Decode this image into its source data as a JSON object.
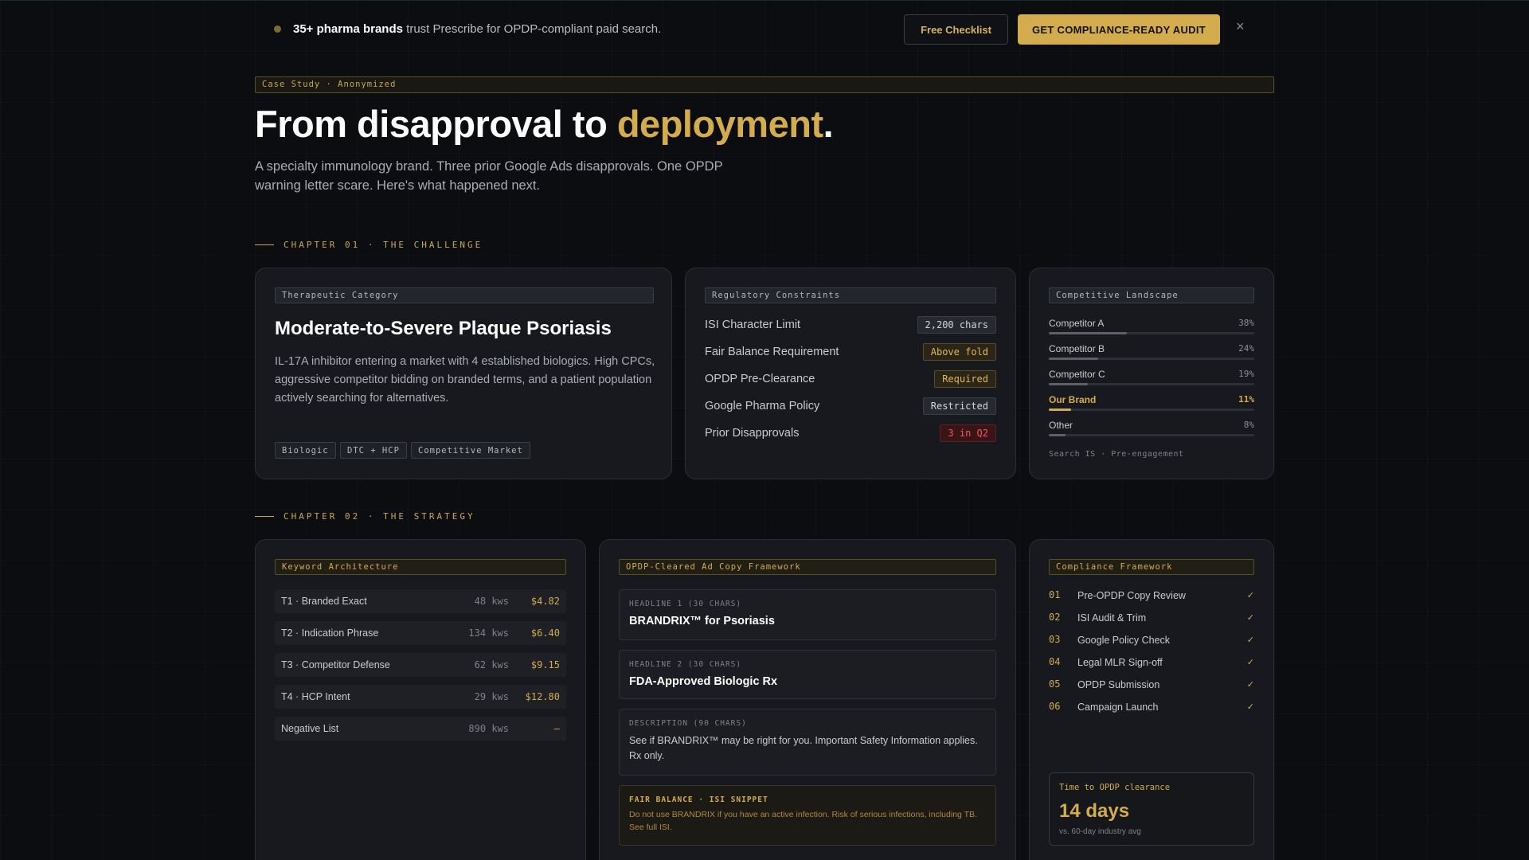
{
  "banner": {
    "highlight": "35+ pharma brands",
    "message": " trust Prescribe for OPDP-compliant paid search.",
    "free_checklist": "Free Checklist",
    "cta": "GET COMPLIANCE-READY AUDIT",
    "close": "×"
  },
  "hero": {
    "eyebrow": "Case Study · Anonymized",
    "title_part1": "From disapproval to ",
    "title_accent": "deployment",
    "title_end": ".",
    "subtitle": "A specialty immunology brand. Three prior Google Ads disapprovals. One OPDP warning letter scare. Here's what happened next."
  },
  "chapter1": "CHAPTER 01 · THE CHALLENGE",
  "chapter2": "CHAPTER 02 · THE STRATEGY",
  "therapeutic": {
    "tag": "Therapeutic Category",
    "title": "Moderate-to-Severe Plaque Psoriasis",
    "description": "IL-17A inhibitor entering a market with 4 established biologics. High CPCs, aggressive competitor bidding on branded terms, and a patient population actively searching for alternatives.",
    "chips": [
      "Biologic",
      "DTC + HCP",
      "Competitive Market"
    ]
  },
  "regulatory": {
    "tag": "Regulatory Constraints",
    "rows": [
      {
        "label": "ISI Character Limit",
        "value": "2,200 chars"
      },
      {
        "label": "Fair Balance Requirement",
        "value": "Above fold"
      },
      {
        "label": "OPDP Pre-Clearance",
        "value": "Required"
      },
      {
        "label": "Google Pharma Policy",
        "value": "Restricted"
      },
      {
        "label": "Prior Disapprovals",
        "value": "3 in Q2"
      }
    ]
  },
  "competitive": {
    "tag": "Competitive Landscape",
    "items": [
      {
        "name": "Competitor A",
        "pct": "38%",
        "share": 38
      },
      {
        "name": "Competitor B",
        "pct": "24%",
        "share": 24
      },
      {
        "name": "Competitor C",
        "pct": "19%",
        "share": 19
      },
      {
        "name": "Our Brand",
        "pct": "11%",
        "share": 11
      },
      {
        "name": "Other",
        "pct": "8%",
        "share": 8
      }
    ],
    "footnote": "Search IS · Pre-engagement"
  },
  "keywords": {
    "tag": "Keyword Architecture",
    "rows": [
      {
        "label": "T1 · Branded Exact",
        "count": "48 kws",
        "cpc": "$4.82"
      },
      {
        "label": "T2 · Indication Phrase",
        "count": "134 kws",
        "cpc": "$6.40"
      },
      {
        "label": "T3 · Competitor Defense",
        "count": "62 kws",
        "cpc": "$9.15"
      },
      {
        "label": "T4 · HCP Intent",
        "count": "29 kws",
        "cpc": "$12.80"
      },
      {
        "label": "Negative List",
        "count": "890 kws",
        "cpc": "—"
      }
    ]
  },
  "adcopy": {
    "tag": "OPDP-Cleared Ad Copy Framework",
    "headline1_caption": "HEADLINE 1 (30 CHARS)",
    "headline1": "BRANDRIX™ for Psoriasis",
    "headline2_caption": "HEADLINE 2 (30 CHARS)",
    "headline2": "FDA-Approved Biologic Rx",
    "description_caption": "DESCRIPTION (90 CHARS)",
    "description": "See if BRANDRIX™ may be right for you. Important Safety Information applies. Rx only.",
    "isi_caption": "FAIR BALANCE · ISI SNIPPET",
    "isi": "Do not use BRANDRIX if you have an active infection. Risk of serious infections, including TB. See full ISI."
  },
  "compliance": {
    "tag": "Compliance Framework",
    "steps": [
      {
        "num": "01",
        "label": "Pre-OPDP Copy Review",
        "check": "✓"
      },
      {
        "num": "02",
        "label": "ISI Audit & Trim",
        "check": "✓"
      },
      {
        "num": "03",
        "label": "Google Policy Check",
        "check": "✓"
      },
      {
        "num": "04",
        "label": "Legal MLR Sign-off",
        "check": "✓"
      },
      {
        "num": "05",
        "label": "OPDP Submission",
        "check": "✓"
      },
      {
        "num": "06",
        "label": "Campaign Launch",
        "check": "✓"
      }
    ],
    "clearance_caption": "Time to OPDP clearance",
    "clearance_value": "14 days",
    "clearance_sub": "vs. 60-day industry avg"
  }
}
